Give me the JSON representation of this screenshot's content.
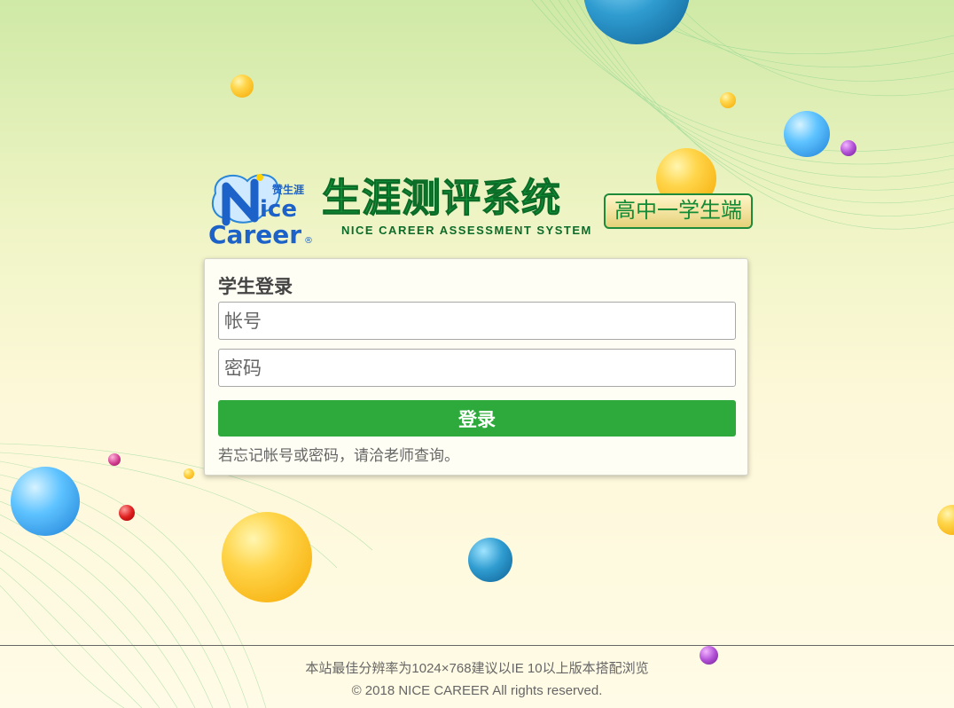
{
  "logo": {
    "mark_top": "赞生涯",
    "mark_text_1": "ice",
    "mark_text_2": "Career",
    "mark_registered": "®",
    "title_cn": "生涯测评系统",
    "title_en": "NICE CAREER ASSESSMENT SYSTEM",
    "badge": "高中一学生端"
  },
  "login": {
    "title": "学生登录",
    "account_placeholder": "帐号",
    "password_placeholder": "密码",
    "submit_label": "登录",
    "hint": "若忘记帐号或密码，请洽老师查询。"
  },
  "footer": {
    "line1": "本站最佳分辨率为1024×768建议以IE 10以上版本搭配浏览",
    "line2": "© 2018 NICE CAREER All rights reserved."
  },
  "colors": {
    "primary_green": "#2eaa3c",
    "title_green": "#129a3a",
    "card_bg": "#fffef4"
  }
}
